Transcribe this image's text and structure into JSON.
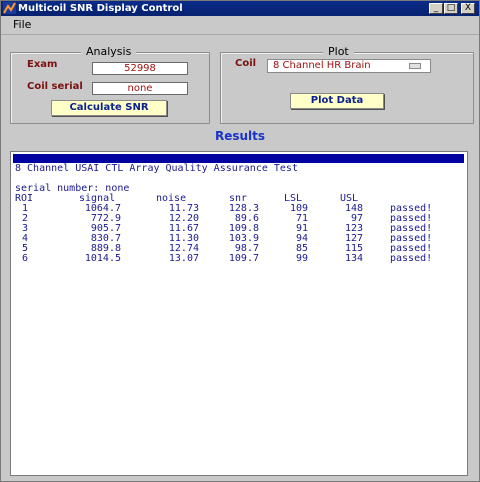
{
  "window": {
    "title": "Multicoil SNR Display Control",
    "controls": [
      "_",
      "□",
      "X"
    ]
  },
  "menu": {
    "file": "File"
  },
  "analysis": {
    "title": "Analysis",
    "exam_label": "Exam",
    "exam_value": "52998",
    "coil_serial_label": "Coil serial",
    "coil_serial_value": "none",
    "calculate_button": "Calculate SNR"
  },
  "plot": {
    "title": "Plot",
    "coil_label": "Coil",
    "coil_selected": "8 Channel HR Brain",
    "plot_button": "Plot Data"
  },
  "results": {
    "title": "Results",
    "test_title": "8 Channel USAI CTL Array Quality Assurance Test",
    "serial_line": "serial number: none",
    "headers": {
      "roi": "ROI",
      "signal": "signal",
      "noise": "noise",
      "snr": "snr",
      "lsl": "LSL",
      "usl": "USL"
    },
    "rows": [
      {
        "roi": "1",
        "signal": "1064.7",
        "noise": "11.73",
        "snr": "128.3",
        "lsl": "109",
        "usl": "148",
        "status": "passed!"
      },
      {
        "roi": "2",
        "signal": "772.9",
        "noise": "12.20",
        "snr": "89.6",
        "lsl": "71",
        "usl": "97",
        "status": "passed!"
      },
      {
        "roi": "3",
        "signal": "905.7",
        "noise": "11.67",
        "snr": "109.8",
        "lsl": "91",
        "usl": "123",
        "status": "passed!"
      },
      {
        "roi": "4",
        "signal": "830.7",
        "noise": "11.30",
        "snr": "103.9",
        "lsl": "94",
        "usl": "127",
        "status": "passed!"
      },
      {
        "roi": "5",
        "signal": "889.8",
        "noise": "12.74",
        "snr": "98.7",
        "lsl": "85",
        "usl": "115",
        "status": "passed!"
      },
      {
        "roi": "6",
        "signal": "1014.5",
        "noise": "13.07",
        "snr": "109.7",
        "lsl": "99",
        "usl": "134",
        "status": "passed!"
      }
    ]
  }
}
